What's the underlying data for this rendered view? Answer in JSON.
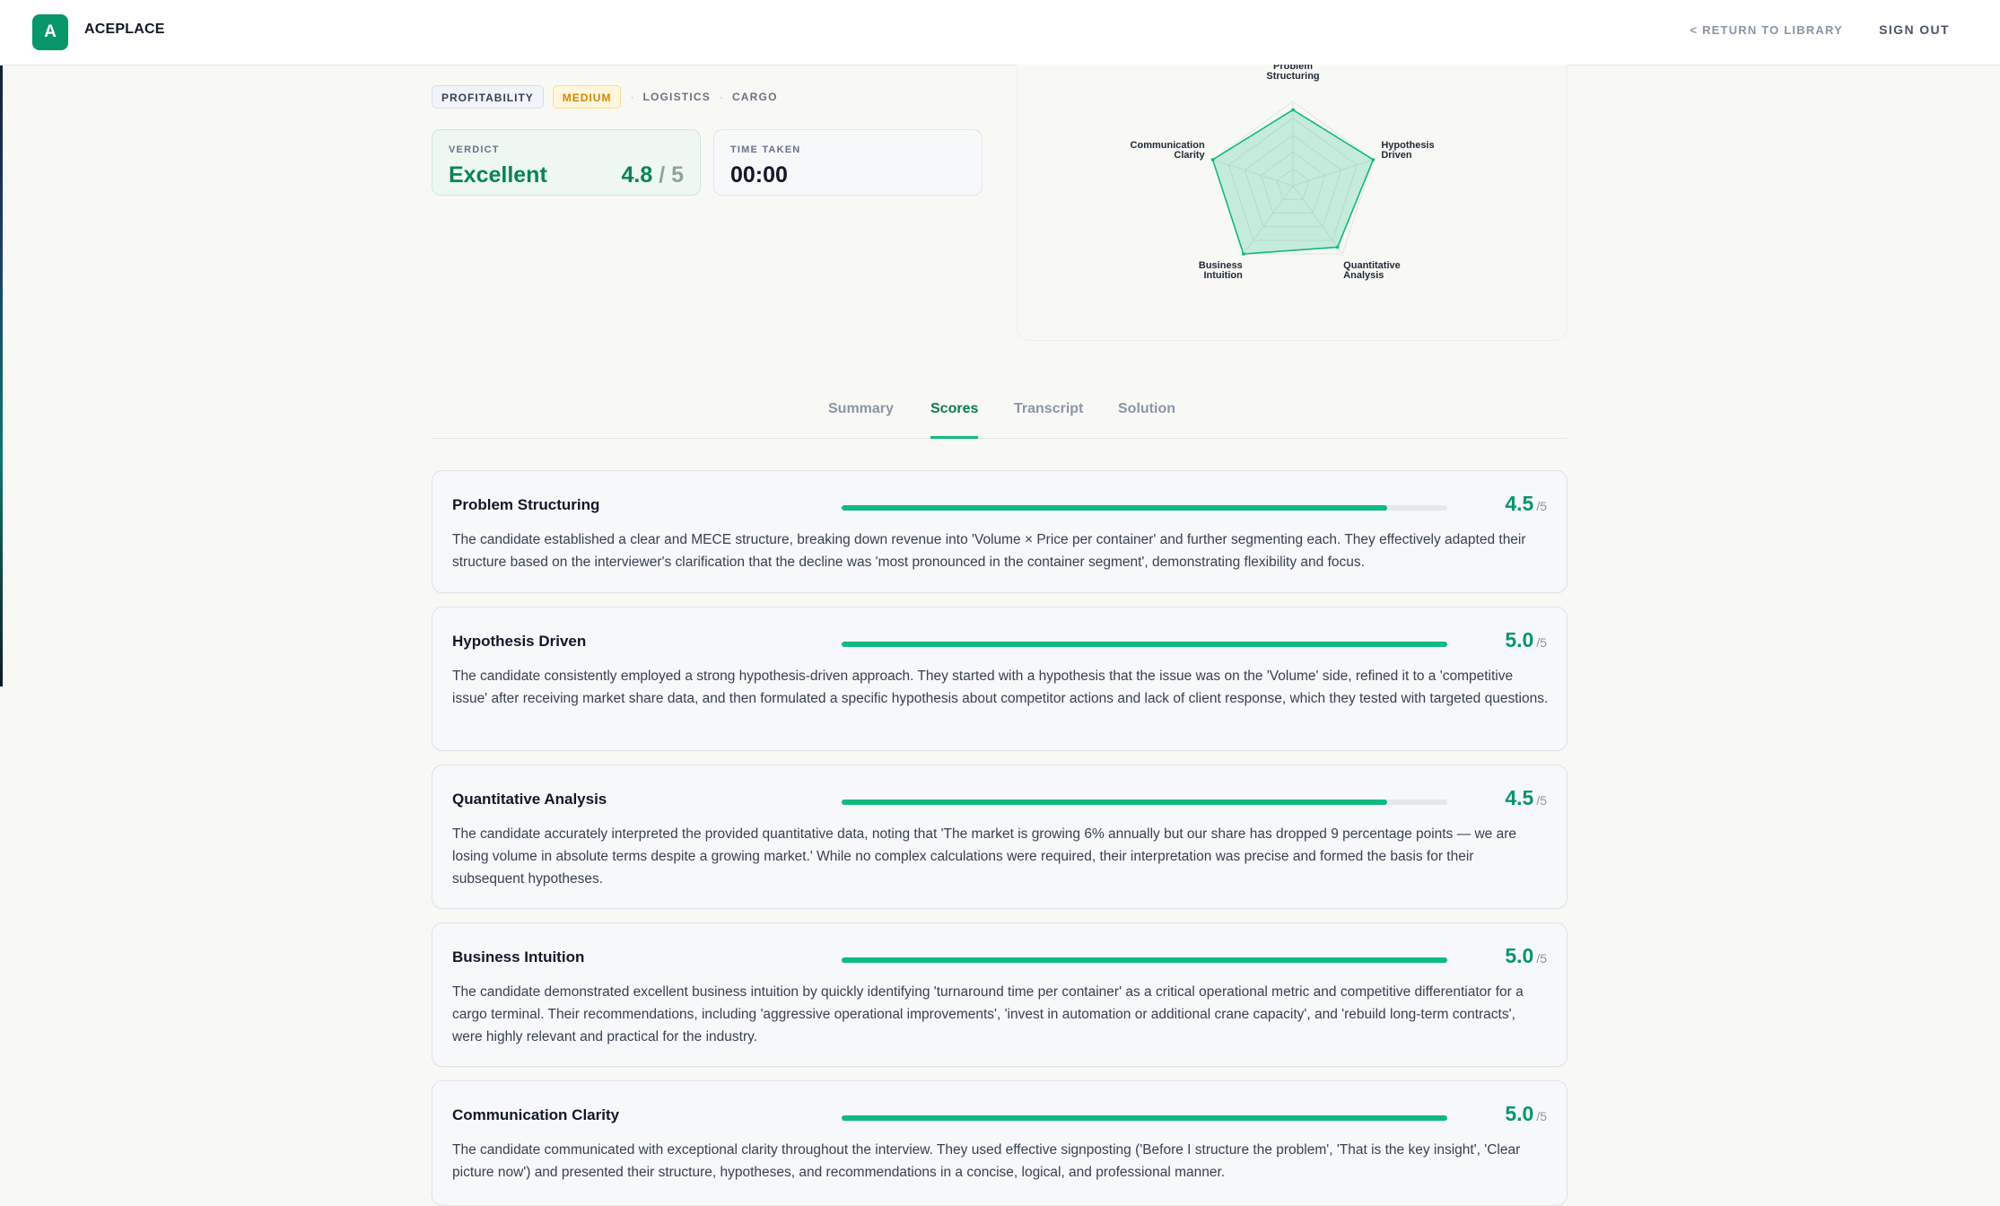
{
  "header": {
    "logo_letter": "A",
    "brand": "ACEPLACE",
    "return_link": "< RETURN TO LIBRARY",
    "sign_out": "SIGN OUT"
  },
  "tags": {
    "category": "PROFITABILITY",
    "difficulty": "MEDIUM",
    "industry": "LOGISTICS",
    "subindustry": "CARGO",
    "separator": "·"
  },
  "verdict": {
    "label": "VERDICT",
    "value": "Excellent",
    "score": "4.8",
    "max": "/ 5"
  },
  "time": {
    "label": "TIME TAKEN",
    "value": "00:00"
  },
  "radar": {
    "max": 5,
    "axes": [
      {
        "label_lines": [
          "Problem",
          "Structuring"
        ],
        "value": 4.5
      },
      {
        "label_lines": [
          "Hypothesis",
          "Driven"
        ],
        "value": 5.0
      },
      {
        "label_lines": [
          "Quantitative",
          "Analysis"
        ],
        "value": 4.5
      },
      {
        "label_lines": [
          "Business",
          "Intuition"
        ],
        "value": 5.0
      },
      {
        "label_lines": [
          "Communication",
          "Clarity"
        ],
        "value": 5.0
      }
    ],
    "accent_color": "#10b981"
  },
  "tabs": [
    {
      "label": "Summary",
      "active": false
    },
    {
      "label": "Scores",
      "active": true
    },
    {
      "label": "Transcript",
      "active": false
    },
    {
      "label": "Solution",
      "active": false
    }
  ],
  "scores": [
    {
      "title": "Problem Structuring",
      "score": "4.5",
      "value": 4.5,
      "max_label": "/5",
      "text": "The candidate established a clear and MECE structure, breaking down revenue into 'Volume × Price per container' and further segmenting each. They effectively adapted their structure based on the interviewer's clarification that the decline was 'most pronounced in the container segment', demonstrating flexibility and focus."
    },
    {
      "title": "Hypothesis Driven",
      "score": "5.0",
      "value": 5.0,
      "max_label": "/5",
      "text": "The candidate consistently employed a strong hypothesis-driven approach. They started with a hypothesis that the issue was on the 'Volume' side, refined it to a 'competitive issue' after receiving market share data, and then formulated a specific hypothesis about competitor actions and lack of client response, which they tested with targeted questions."
    },
    {
      "title": "Quantitative Analysis",
      "score": "4.5",
      "value": 4.5,
      "max_label": "/5",
      "text": "The candidate accurately interpreted the provided quantitative data, noting that 'The market is growing 6% annually but our share has dropped 9 percentage points — we are losing volume in absolute terms despite a growing market.' While no complex calculations were required, their interpretation was precise and formed the basis for their subsequent hypotheses."
    },
    {
      "title": "Business Intuition",
      "score": "5.0",
      "value": 5.0,
      "max_label": "/5",
      "text": "The candidate demonstrated excellent business intuition by quickly identifying 'turnaround time per container' as a critical operational metric and competitive differentiator for a cargo terminal. Their recommendations, including 'aggressive operational improvements', 'invest in automation or additional crane capacity', and 'rebuild long-term contracts', were highly relevant and practical for the industry."
    },
    {
      "title": "Communication Clarity",
      "score": "5.0",
      "value": 5.0,
      "max_label": "/5",
      "text": "The candidate communicated with exceptional clarity throughout the interview. They used effective signposting ('Before I structure the problem', 'That is the key insight', 'Clear picture now') and presented their structure, hypotheses, and recommendations in a concise, logical, and professional manner."
    }
  ]
}
